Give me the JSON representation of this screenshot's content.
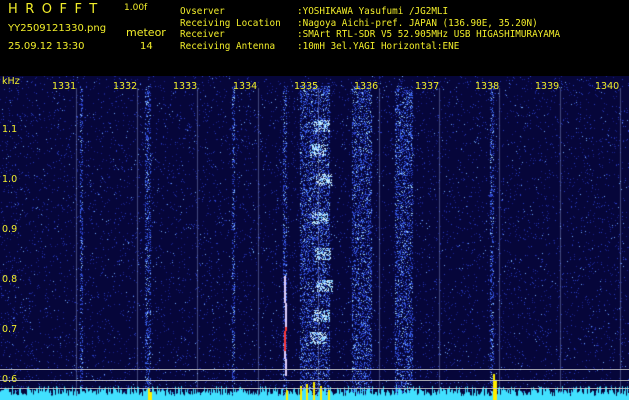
{
  "header": {
    "app_title": "HROFFT",
    "version": "1.00f",
    "file_name": "YY2509121330.png",
    "date_time": "25.09.12 13:30",
    "meteor_label": "meteor",
    "meteor_count": "14"
  },
  "station_info": [
    {
      "key": "Ovserver",
      "value": ":YOSHIKAWA Yasufumi /JG2MLI"
    },
    {
      "key": "Receiving Location",
      "value": ":Nagoya Aichi-pref. JAPAN (136.90E, 35.20N)"
    },
    {
      "key": "Receiver",
      "value": ":SMArt RTL-SDR V5 52.905MHz USB HIGASHIMURAYAMA"
    },
    {
      "key": "Receiving Antenna",
      "value": ":10mH 3el.YAGI Horizontal:ENE"
    }
  ],
  "spectrogram": {
    "y_unit": "kHz",
    "time_ticks": [
      "1331",
      "1332",
      "1333",
      "1334",
      "1335",
      "1336",
      "1337",
      "1338",
      "1339",
      "1340"
    ],
    "freq_ticks": [
      "1.1",
      "1.0",
      "0.9",
      "0.8",
      "0.7",
      "0.6"
    ],
    "colors": {
      "background": "#06063a",
      "label": "#f2ee2a",
      "signal": "#41e0ff",
      "hot": "#ffee00"
    }
  }
}
